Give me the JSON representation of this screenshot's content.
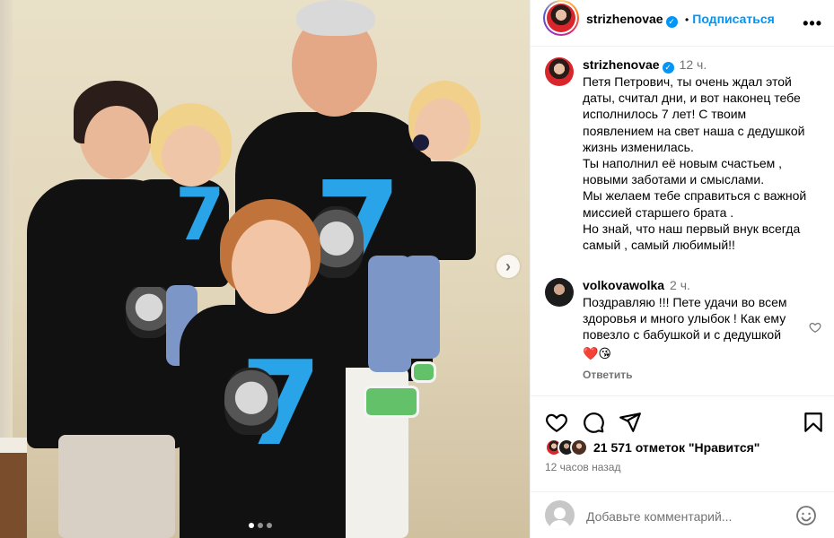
{
  "post": {
    "author": "strizhenovae",
    "verified_mark": "✓",
    "separator": "•",
    "follow_label": "Подписаться",
    "more_glyph": "•••",
    "caption_time": "12 ч.",
    "caption": "Петя Петрович, ты очень ждал этой\nдаты, считал дни, и вот наконец тебе\nисполнилось 7 лет! С твоим\nпоявлением на свет наша с дедушкой\nжизнь изменилась.\nТы наполнил её новым счастьем ,\nновыми заботами и смыслами.\nМы желаем тебе справиться с важной\nмиссией старшего брата .\nНо знай, что наш первый внук всегда\nсамый , самый любимый!!"
  },
  "comment": {
    "author": "volkovawolka",
    "time": "2 ч.",
    "text": "Поздравляю !!! Пете удачи во всем\nздоровья и много улыбок ! Как ему\nповезло с бабушкой и с дедушкой",
    "emojis": "❤️😘",
    "reply_label": "Ответить"
  },
  "stats": {
    "likes_text": "21 571 отметок \"Нравится\"",
    "time_ago": "12 часов назад"
  },
  "comment_input": {
    "placeholder": "Добавьте комментарий..."
  },
  "carousel": {
    "next_glyph": "›",
    "slide_count": 3,
    "active_slide": 1
  },
  "photo_print": {
    "number_glyph": "7"
  },
  "colors": {
    "link_blue": "#0095f6",
    "secondary_text": "#737373",
    "shirt_print": "#2aa4e8"
  },
  "icons": [
    "heart-icon",
    "comment-icon",
    "share-icon",
    "bookmark-icon",
    "emoji-icon",
    "more-icon",
    "next-arrow-icon",
    "like-heart-icon"
  ]
}
